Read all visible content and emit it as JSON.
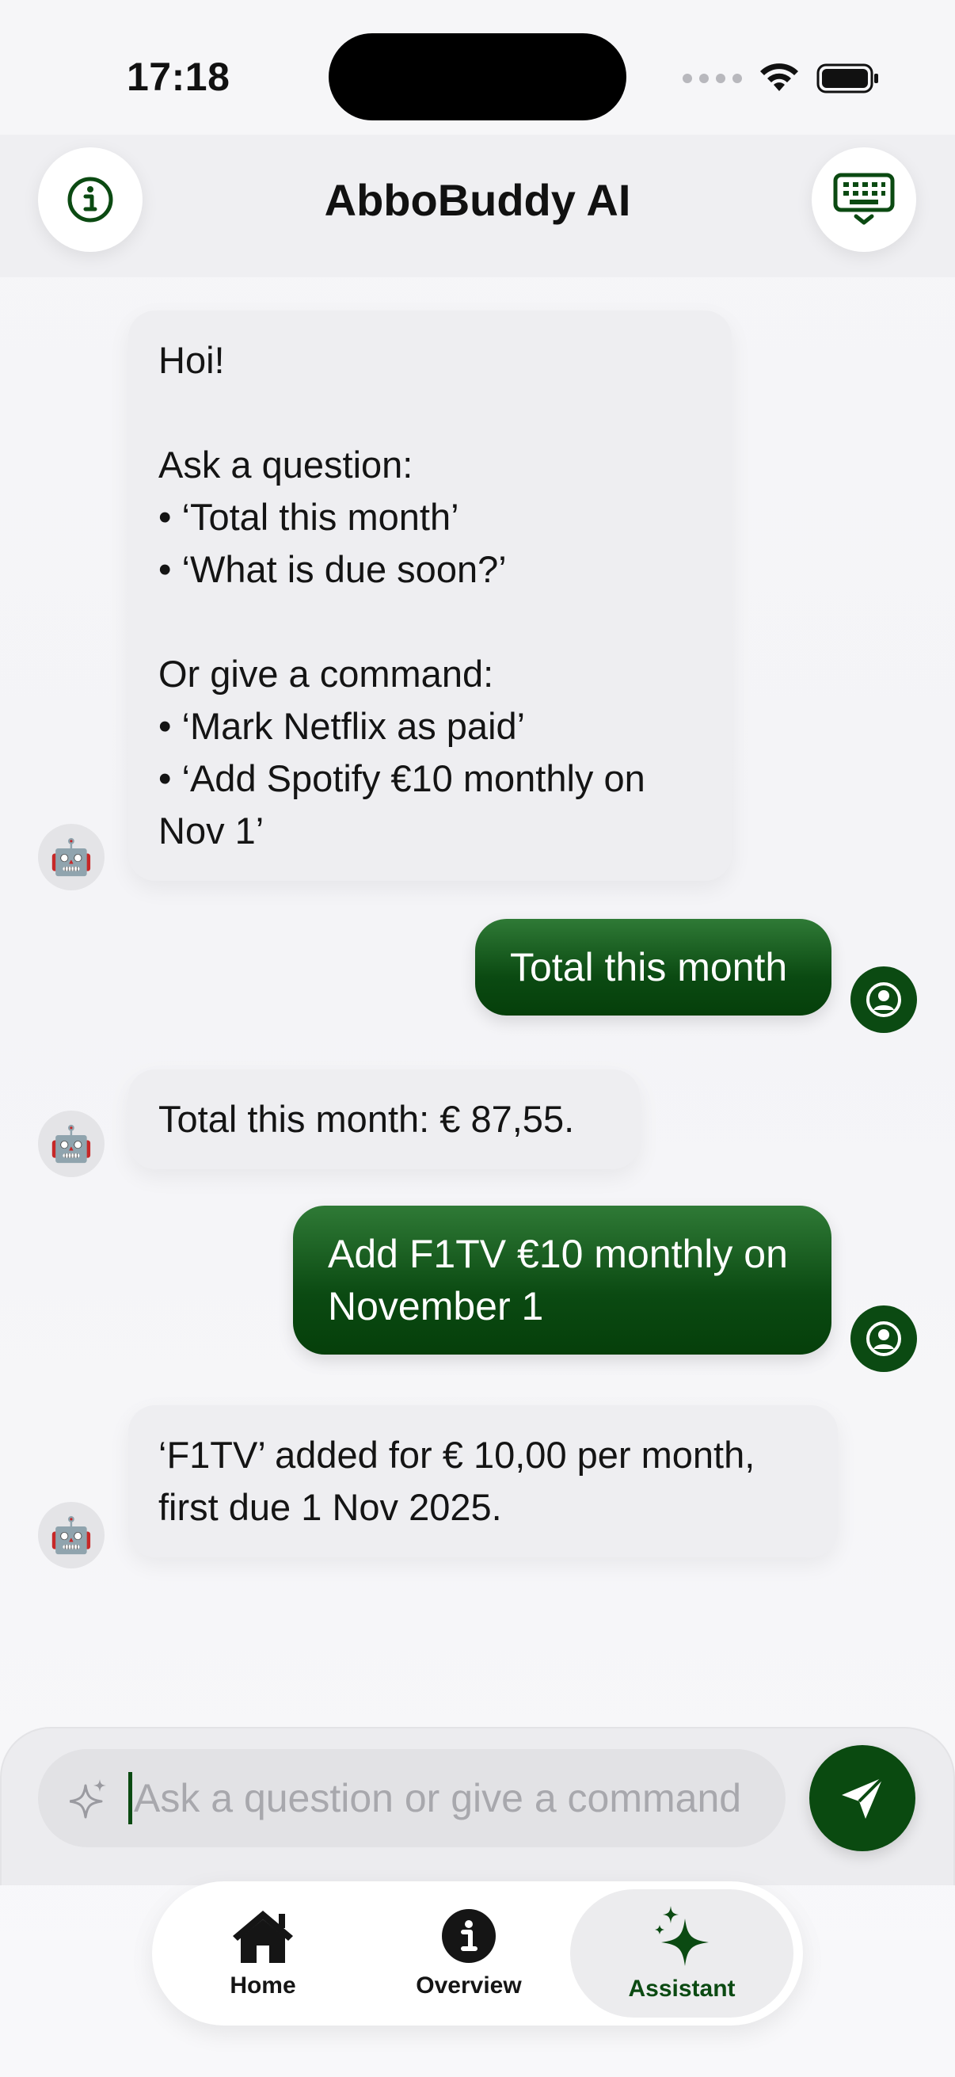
{
  "status_bar": {
    "time": "17:18"
  },
  "header": {
    "title": "AbboBuddy AI",
    "info_icon": "info-circle-icon",
    "keyboard_icon": "keyboard-dismiss-icon"
  },
  "colors": {
    "accent": "#0b4a12",
    "bot_bubble": "#eeeef1",
    "background": "#f5f5f7"
  },
  "messages": [
    {
      "sender": "bot",
      "avatar": "🤖",
      "lines": [
        "Hoi!",
        "",
        "Ask a question:",
        "• ‘Total this month’",
        "• ‘What is due soon?’",
        "",
        "Or give a command:",
        "• ‘Mark Netflix as paid’",
        "• ‘Add Spotify €10 monthly on",
        "Nov 1’"
      ]
    },
    {
      "sender": "user",
      "lines": [
        "Total this month"
      ]
    },
    {
      "sender": "bot",
      "avatar": "🤖",
      "lines": [
        "Total this month: € 87,55."
      ]
    },
    {
      "sender": "user",
      "lines": [
        "Add F1TV €10 monthly on",
        "November 1"
      ]
    },
    {
      "sender": "bot",
      "avatar": "🤖",
      "lines": [
        "‘F1TV’ added for € 10,00 per month,",
        "first due 1 Nov 2025."
      ]
    }
  ],
  "input": {
    "placeholder": "Ask a question or give a command",
    "value": ""
  },
  "tabs": [
    {
      "label": "Home",
      "icon": "house-icon",
      "selected": false
    },
    {
      "label": "Overview",
      "icon": "info-circle-icon",
      "selected": false
    },
    {
      "label": "Assistant",
      "icon": "sparkles-icon",
      "selected": true
    }
  ]
}
